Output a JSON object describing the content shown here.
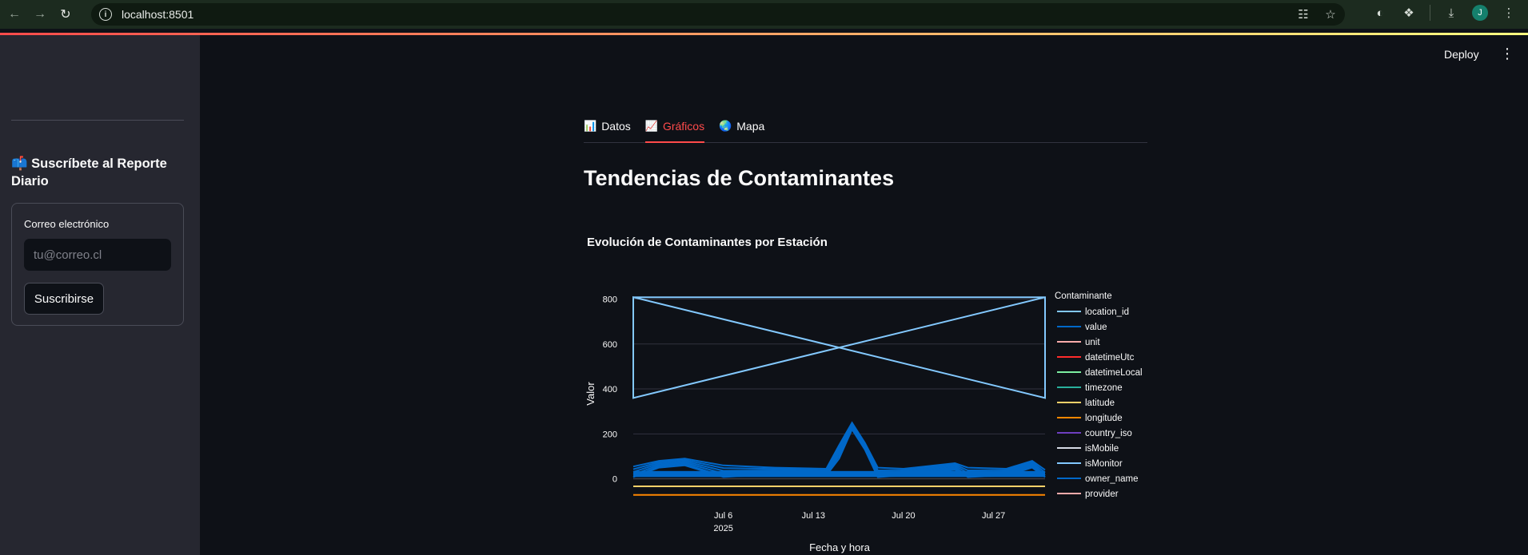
{
  "browser": {
    "url": "localhost:8501",
    "avatar_letter": "J"
  },
  "app": {
    "deploy_label": "Deploy"
  },
  "sidebar": {
    "subscribe_title": "📫 Suscríbete al Reporte Diario",
    "email_label": "Correo electrónico",
    "email_placeholder": "tu@correo.cl",
    "subscribe_button": "Suscribirse"
  },
  "tabs": [
    {
      "icon": "📊",
      "label": "Datos",
      "active": false
    },
    {
      "icon": "📈",
      "label": "Gráficos",
      "active": true
    },
    {
      "icon": "🌏",
      "label": "Mapa",
      "active": false
    }
  ],
  "page_title": "Tendencias de Contaminantes",
  "chart_data": {
    "type": "line",
    "title": "Evolución de Contaminantes por Estación",
    "xlabel": "Fecha y hora",
    "ylabel": "Valor",
    "x_ticks": [
      "Jul 6",
      "Jul 13",
      "Jul 20",
      "Jul 27"
    ],
    "x_year_label": "2025",
    "x_range": [
      "2025-06-29",
      "2025-07-31"
    ],
    "ylim": [
      -90,
      830
    ],
    "y_ticks": [
      0,
      200,
      400,
      600,
      800
    ],
    "grid": true,
    "legend_title": "Contaminante",
    "legend_position": "right",
    "series": [
      {
        "name": "location_id",
        "color": "#83c9ff",
        "x": [
          "2025-06-29",
          "2025-07-31",
          "2025-07-31",
          "2025-06-29",
          "2025-06-29",
          "2025-07-31",
          "2025-06-29"
        ],
        "y": [
          808,
          808,
          360,
          808,
          360,
          808,
          360
        ]
      },
      {
        "name": "value",
        "color": "#0068c9",
        "x": [
          "2025-06-29",
          "2025-07-01",
          "2025-07-03",
          "2025-07-06",
          "2025-07-10",
          "2025-07-14",
          "2025-07-15",
          "2025-07-16",
          "2025-07-17",
          "2025-07-18",
          "2025-07-20",
          "2025-07-24",
          "2025-07-25",
          "2025-07-28",
          "2025-07-30",
          "2025-07-31"
        ],
        "y": [
          55,
          80,
          90,
          60,
          50,
          45,
          150,
          250,
          160,
          50,
          45,
          70,
          50,
          45,
          80,
          40
        ]
      },
      {
        "name": "unit",
        "color": "#ffabab",
        "x": [],
        "y": []
      },
      {
        "name": "datetimeUtc",
        "color": "#ff2b2b",
        "x": [],
        "y": []
      },
      {
        "name": "datetimeLocal",
        "color": "#7defa1",
        "x": [],
        "y": []
      },
      {
        "name": "timezone",
        "color": "#29b09d",
        "x": [],
        "y": []
      },
      {
        "name": "latitude",
        "color": "#ffd16a",
        "x": [
          "2025-06-29",
          "2025-07-31"
        ],
        "y": [
          -33,
          -33
        ]
      },
      {
        "name": "longitude",
        "color": "#ff8700",
        "x": [
          "2025-06-29",
          "2025-07-31"
        ],
        "y": [
          -71,
          -71
        ]
      },
      {
        "name": "country_iso",
        "color": "#6d3fc0",
        "x": [],
        "y": []
      },
      {
        "name": "isMobile",
        "color": "#d5dae5",
        "x": [],
        "y": []
      },
      {
        "name": "isMonitor",
        "color": "#83c9ff",
        "x": [],
        "y": []
      },
      {
        "name": "owner_name",
        "color": "#0068c9",
        "x": [],
        "y": []
      },
      {
        "name": "provider",
        "color": "#ffabab",
        "x": [],
        "y": []
      }
    ]
  }
}
